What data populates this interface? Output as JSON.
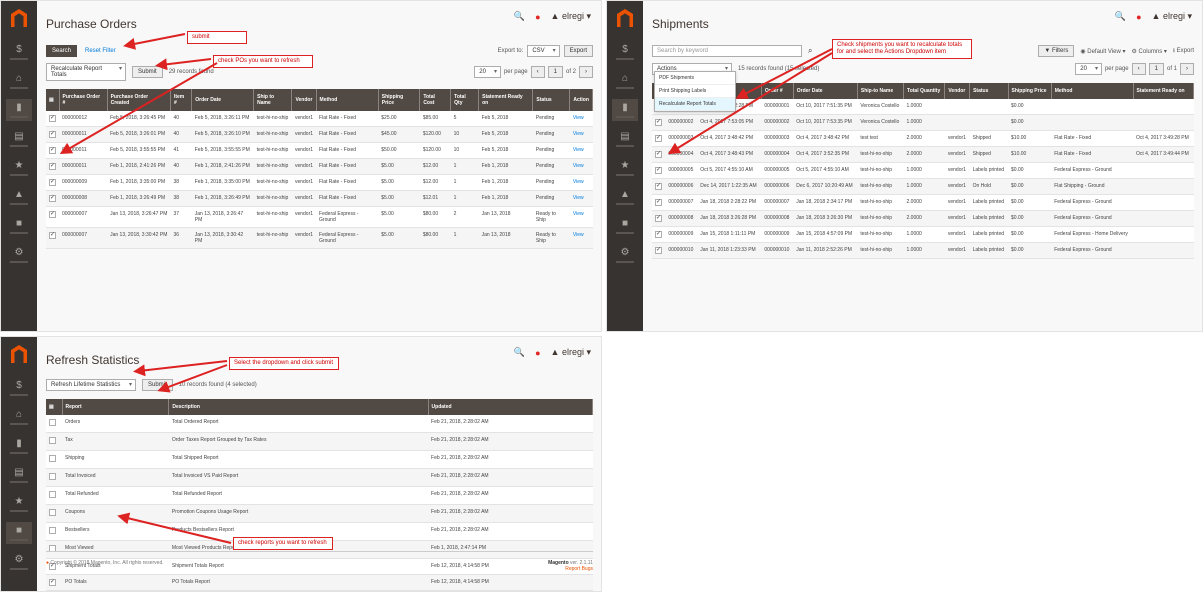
{
  "nav": [
    "$",
    "⌂",
    "▮",
    "▤",
    "★",
    "▲",
    "■",
    "⚙"
  ],
  "common": {
    "user": "▲ elregi ▾",
    "view": "View",
    "checked": "✓"
  },
  "po": {
    "title": "Purchase Orders",
    "search_btn": "Search",
    "reset_filter": "Reset Filter",
    "action_select": "Recalculate Report Totals",
    "submit": "Submit",
    "records": "29 records found",
    "export_label": "Export to:",
    "export_format": "CSV",
    "export_btn": "Export",
    "per_page_value": "20",
    "per_page_label": "per page",
    "page_num": "1",
    "page_of": "of 2",
    "callout_submit": "submit",
    "callout_check": "check POs you want to refresh",
    "columns": [
      "Purchase Order #",
      "Purchase Order Created",
      "Item #",
      "Order Date",
      "Ship to Name",
      "Vendor",
      "Method",
      "Shipping Price",
      "Total Cost",
      "Total Qty",
      "Statement Ready on",
      "Status",
      "Action"
    ],
    "rows": [
      [
        "000000012",
        "Feb 5, 2018, 3:26:45 PM",
        "40",
        "Feb 5, 2018, 3:26:11 PM",
        "test-hi-no-ship",
        "vendor1",
        "Flat Rate - Fixed",
        "$25.00",
        "$85.00",
        "5",
        "Feb 5, 2018",
        "Pending"
      ],
      [
        "000000011",
        "Feb 5, 2018, 3:26:01 PM",
        "40",
        "Feb 5, 2018, 3:26:10 PM",
        "test-hi-no-ship",
        "vendor1",
        "Flat Rate - Fixed",
        "$45.00",
        "$120.00",
        "10",
        "Feb 5, 2018",
        "Pending"
      ],
      [
        "000000011",
        "Feb 5, 2018, 3:55:55 PM",
        "41",
        "Feb 5, 2018, 3:55:55 PM",
        "test-hi-no-ship",
        "vendor1",
        "Flat Rate - Fixed",
        "$50.00",
        "$120.00",
        "10",
        "Feb 5, 2018",
        "Pending"
      ],
      [
        "000000011",
        "Feb 1, 2018, 2:41:26 PM",
        "40",
        "Feb 1, 2018, 2:41:26 PM",
        "test-hi-no-ship",
        "vendor1",
        "Flat Rate - Fixed",
        "$5.00",
        "$12.00",
        "1",
        "Feb 1, 2018",
        "Pending"
      ],
      [
        "000000009",
        "Feb 1, 2018, 3:35:00 PM",
        "38",
        "Feb 1, 2018, 3:35:00 PM",
        "test-hi-no-ship",
        "vendor1",
        "Flat Rate - Fixed",
        "$5.00",
        "$12.00",
        "1",
        "Feb 1, 2018",
        "Pending"
      ],
      [
        "000000008",
        "Feb 1, 2018, 3:26:49 PM",
        "38",
        "Feb 1, 2018, 3:26:49 PM",
        "test-hi-no-ship",
        "vendor1",
        "Flat Rate - Fixed",
        "$5.00",
        "$12.01",
        "1",
        "Feb 1, 2018",
        "Pending"
      ],
      [
        "000000007",
        "Jan 13, 2018, 3:26:47 PM",
        "37",
        "Jan 13, 2018, 3:26:47 PM",
        "test-hi-no-ship",
        "vendor1",
        "Federal Express - Ground",
        "$5.00",
        "$80.00",
        "2",
        "Jan 13, 2018",
        "Ready to Ship"
      ],
      [
        "000000007",
        "Jan 13, 2018, 3:30:42 PM",
        "36",
        "Jan 13, 2018, 3:30:42 PM",
        "test-hi-no-ship",
        "vendor1",
        "Federal Express - Ground",
        "$5.00",
        "$80.00",
        "1",
        "Jan 13, 2018",
        "Ready to Ship"
      ]
    ]
  },
  "sh": {
    "title": "Shipments",
    "search_placeholder": "Search by keyword",
    "filters_btn": "▼ Filters",
    "default_view": "◉ Default View ▾",
    "columns_btn": "⚙ Columns ▾",
    "export_btn": "⭳ Export",
    "actions_label": "Actions",
    "actions_options": [
      "PDF Shipments",
      "Print Shipping Labels",
      "Recalculate Report Totals"
    ],
    "records": "15 records found (15 selected)",
    "per_page_value": "20",
    "per_page_label": "per page",
    "page_num": "1",
    "page_of": "of 1",
    "callout": "Check shipments you want to recalculate totals for and select the Actions Dropdown item",
    "columns": [
      "Ship Date",
      "Order #",
      "Order Date",
      "Ship-to Name",
      "Total Quantity",
      "Vendor",
      "Status",
      "Shipping Price",
      "Method",
      "Statement Ready on"
    ],
    "rows": [
      [
        "Oct 4, 2017 7:52:28 PM",
        "000000001",
        "Oct 10, 2017 7:51:35 PM",
        "Veronica Costello",
        "1.0000",
        "",
        "",
        "$0.00",
        "",
        ""
      ],
      [
        "Oct 4, 2017 7:53:05 PM",
        "000000002",
        "Oct 10, 2017 7:53:35 PM",
        "Veronica Costello",
        "1.0000",
        "",
        "",
        "$0.00",
        "",
        ""
      ],
      [
        "Oct 4, 2017 3:48:42 PM",
        "000000003",
        "Oct 4, 2017 3:48:42 PM",
        "test test",
        "2.0000",
        "vendor1",
        "Shipped",
        "$10.00",
        "Flat Rate - Fixed",
        "Oct 4, 2017 3:49:28 PM"
      ],
      [
        "Oct 4, 2017 3:48:43 PM",
        "000000004",
        "Oct 4, 2017 3:52:35 PM",
        "test-hi-no-ship",
        "2.0000",
        "vendor1",
        "Shipped",
        "$10.00",
        "Flat Rate - Fixed",
        "Oct 4, 2017 3:49:44 PM"
      ],
      [
        "Oct 5, 2017 4:55:10 AM",
        "000000005",
        "Oct 5, 2017 4:55:10 AM",
        "test-hi-no-ship",
        "1.0000",
        "vendor1",
        "Labels printed",
        "$0.00",
        "Federal Express - Ground",
        ""
      ],
      [
        "Dec 14, 2017 1:22:35 AM",
        "000000006",
        "Dec 6, 2017 10:20:49 AM",
        "test-hi-no-ship",
        "1.0000",
        "vendor1",
        "On Hold",
        "$0.00",
        "Flat Shipping - Ground",
        ""
      ],
      [
        "Jan 18, 2018 2:28:22 PM",
        "000000007",
        "Jan 18, 2018 2:34:17 PM",
        "test-hi-no-ship",
        "2.0000",
        "vendor1",
        "Labels printed",
        "$0.00",
        "Federal Express - Ground",
        ""
      ],
      [
        "Jan 18, 2018 3:26:28 PM",
        "000000008",
        "Jan 18, 2018 3:26:30 PM",
        "test-hi-no-ship",
        "2.0000",
        "vendor1",
        "Labels printed",
        "$0.00",
        "Federal Express - Ground",
        ""
      ],
      [
        "Jan 15, 2018 1:11:11 PM",
        "000000009",
        "Jan 15, 2018 4:57:09 PM",
        "test-hi-no-ship",
        "1.0000",
        "vendor1",
        "Labels printed",
        "$0.00",
        "Federal Express - Home Delivery",
        ""
      ],
      [
        "Jan 11, 2018 1:23:33 PM",
        "000000010",
        "Jan 11, 2018 2:52:26 PM",
        "test-hi-no-ship",
        "1.0000",
        "vendor1",
        "Labels printed",
        "$0.00",
        "Federal Express - Ground",
        ""
      ]
    ]
  },
  "rs": {
    "title": "Refresh Statistics",
    "action_select": "Refresh Lifetime Statistics",
    "submit": "Submit",
    "records": "10 records found (4 selected)",
    "callout_top": "Select the dropdown and click submit",
    "callout_bottom": "check reports you want to refresh",
    "columns": [
      "Report",
      "Description",
      "Updated"
    ],
    "rows": [
      [
        "Orders",
        "Total Ordered Report",
        "Feb 21, 2018, 2:28:02 AM"
      ],
      [
        "Tax",
        "Order Taxes Report Grouped by Tax Rates",
        "Feb 21, 2018, 2:28:02 AM"
      ],
      [
        "Shipping",
        "Total Shipped Report",
        "Feb 21, 2018, 2:28:02 AM"
      ],
      [
        "Total Invoiced",
        "Total Invoiced VS Paid Report",
        "Feb 21, 2018, 2:28:02 AM"
      ],
      [
        "Total Refunded",
        "Total Refunded Report",
        "Feb 21, 2018, 2:28:02 AM"
      ],
      [
        "Coupons",
        "Promotion Coupons Usage Report",
        "Feb 21, 2018, 2:28:02 AM"
      ],
      [
        "Bestsellers",
        "Products Bestsellers Report",
        "Feb 21, 2018, 2:28:02 AM"
      ],
      [
        "Most Viewed",
        "Most Viewed Products Report",
        "Feb 1, 2018, 2:47:14 PM"
      ],
      [
        "Shipment Totals",
        "Shipment Totals Report",
        "Feb 12, 2018, 4:14:58 PM"
      ],
      [
        "PO Totals",
        "PO Totals Report",
        "Feb 12, 2018, 4:14:58 PM"
      ]
    ],
    "checked_rows": [
      8,
      9
    ],
    "footer_left": "Copyright © 2018 Magento, Inc. All rights reserved.",
    "footer_mag": "Magento",
    "footer_ver": "ver. 2.1.11",
    "footer_report": "Report Bugs"
  },
  "colors": {
    "accent": "#eb5202",
    "header_dark": "#514943",
    "sidebar": "#373330",
    "callout": "#dd2222",
    "link": "#007bdb"
  }
}
